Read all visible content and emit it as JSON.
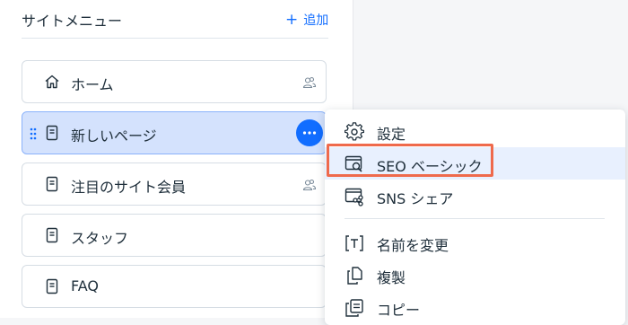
{
  "panel": {
    "title": "サイトメニュー",
    "add_label": "追加"
  },
  "pages": [
    {
      "label": "ホーム",
      "icon": "home-icon",
      "members_only": true,
      "selected": false
    },
    {
      "label": "新しいページ",
      "icon": "page-icon",
      "members_only": false,
      "selected": true
    },
    {
      "label": "注目のサイト会員",
      "icon": "page-icon",
      "members_only": true,
      "selected": false
    },
    {
      "label": "スタッフ",
      "icon": "page-icon",
      "members_only": false,
      "selected": false
    },
    {
      "label": "FAQ",
      "icon": "page-icon",
      "members_only": false,
      "selected": false
    }
  ],
  "context_menu": {
    "items": [
      {
        "label": "設定",
        "icon": "gear-icon"
      },
      {
        "label": "SEO ベーシック",
        "icon": "seo-search-icon",
        "highlighted": true
      },
      {
        "label": "SNS シェア",
        "icon": "social-share-icon"
      },
      {
        "label": "名前を変更",
        "icon": "rename-icon"
      },
      {
        "label": "複製",
        "icon": "duplicate-icon"
      },
      {
        "label": "コピー",
        "icon": "copy-icon"
      }
    ]
  },
  "colors": {
    "accent": "#116dff",
    "selected_bg": "#d4e2fd",
    "highlight_outline": "#ef6a4c"
  }
}
